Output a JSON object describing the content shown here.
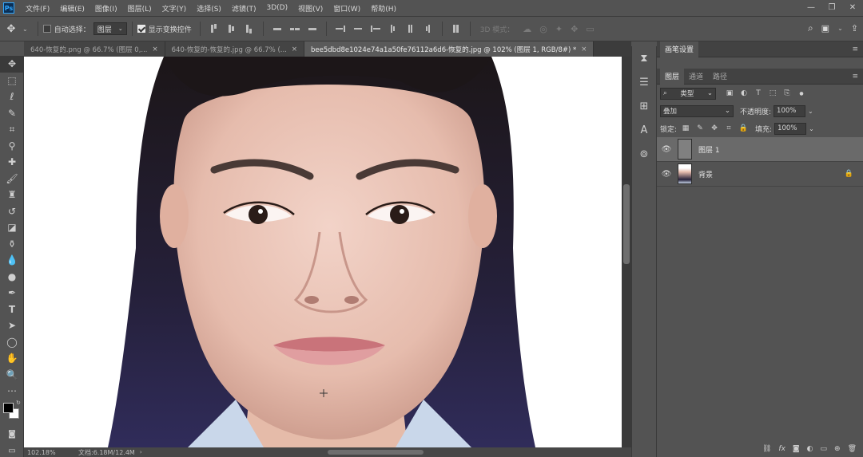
{
  "app": {
    "logo": "Ps",
    "menu": [
      "文件(F)",
      "编辑(E)",
      "图像(I)",
      "图层(L)",
      "文字(Y)",
      "选择(S)",
      "滤镜(T)",
      "3D(D)",
      "视图(V)",
      "窗口(W)",
      "帮助(H)"
    ],
    "window_controls": [
      "minimize-icon",
      "restore-icon",
      "close-icon"
    ]
  },
  "options": {
    "auto_select_label": "自动选择：",
    "auto_select_checked": false,
    "auto_select_value": "图层",
    "show_transform_label": "显示变换控件",
    "show_transform_checked": true,
    "mode_3d_label": "3D 模式："
  },
  "tabs": [
    {
      "label": "640-恢复的.png @ 66.7% (图层 0,...",
      "active": false
    },
    {
      "label": "640-恢复的-恢复的.jpg @ 66.7% (...",
      "active": false
    },
    {
      "label": "bee5dbd8e1024e74a1a50fe76112a6d6-恢复的.jpg @ 102% (图层 1, RGB/8#) *",
      "active": true
    }
  ],
  "toolbar": {
    "tools": [
      "move-tool",
      "marquee-tool",
      "lasso-tool",
      "quick-select-tool",
      "crop-tool",
      "eyedropper-tool",
      "healing-brush-tool",
      "brush-tool",
      "clone-stamp-tool",
      "history-brush-tool",
      "eraser-tool",
      "paint-bucket-tool",
      "blur-tool",
      "dodge-tool",
      "pen-tool",
      "type-tool",
      "path-select-tool",
      "ellipse-tool",
      "hand-tool",
      "zoom-tool",
      "more-tools"
    ],
    "foreground_color": "#000000",
    "background_color": "#ffffff"
  },
  "status": {
    "zoom": "102.18%",
    "doc_size": "文档:6.18M/12.4M"
  },
  "panels": {
    "brush_settings_tab": "画笔设置",
    "layers_tabs": [
      "图层",
      "通道",
      "路径"
    ],
    "filter_type": "类型",
    "blend_mode": "叠加",
    "opacity_label": "不透明度:",
    "opacity_value": "100%",
    "lock_label": "锁定:",
    "fill_label": "填充:",
    "fill_value": "100%",
    "layers": [
      {
        "name": "图层 1",
        "selected": true,
        "visible": true,
        "locked": false
      },
      {
        "name": "背景",
        "selected": false,
        "visible": true,
        "locked": true
      }
    ],
    "footer_icons": [
      "link-icon",
      "fx-icon",
      "mask-icon",
      "adjustment-icon",
      "group-icon",
      "new-layer-icon",
      "trash-icon"
    ]
  }
}
